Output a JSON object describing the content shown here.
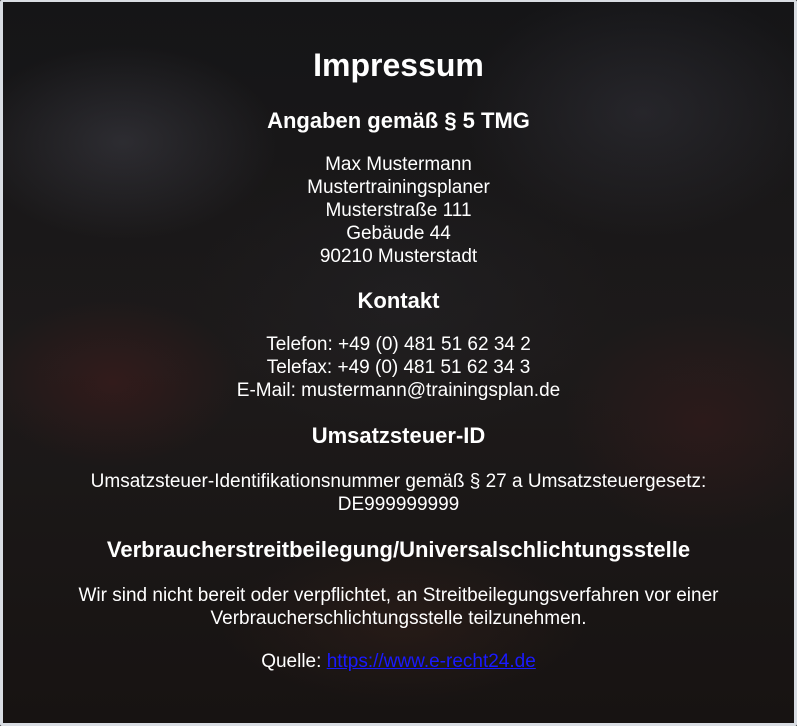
{
  "title": "Impressum",
  "sections": {
    "angaben": {
      "heading": "Angaben gemäß § 5 TMG",
      "lines": [
        "Max Mustermann",
        "Mustertrainingsplaner",
        "Musterstraße 111",
        "Gebäude 44",
        "90210 Musterstadt"
      ]
    },
    "kontakt": {
      "heading": "Kontakt",
      "phone": "Telefon: +49 (0) 481 51 62 34 2",
      "fax": "Telefax: +49 (0) 481 51 62 34 3",
      "email": "E-Mail: mustermann@trainingsplan.de"
    },
    "ust": {
      "heading": "Umsatzsteuer-ID",
      "line1": "Umsatzsteuer-Identifikationsnummer gemäß § 27 a Umsatzsteuergesetz:",
      "line2": "DE999999999"
    },
    "vsbg": {
      "heading": "Verbraucherstreitbeilegung/Universalschlichtungsstelle",
      "line1": "Wir sind nicht bereit oder verpflichtet, an Streitbeilegungsverfahren vor einer",
      "line2": "Verbraucherschlichtungsstelle teilzunehmen."
    }
  },
  "source": {
    "label": "Quelle: ",
    "link_text": "https://www.e-recht24.de"
  },
  "colors": {
    "text": "#ffffff",
    "link": "#1a1aff",
    "background": "#1c1c1c"
  }
}
